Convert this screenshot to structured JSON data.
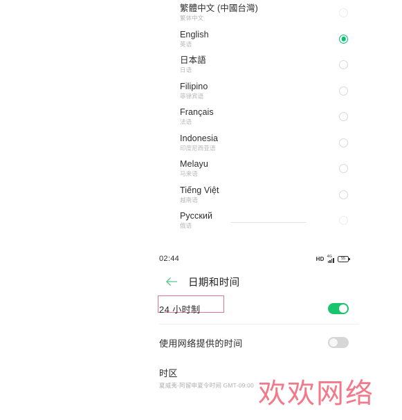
{
  "language_screen": {
    "items": [
      {
        "title": "繁體中文 (中國台灣)",
        "subtitle": "繁体中文",
        "selected": false
      },
      {
        "title": "English",
        "subtitle": "英语",
        "selected": true
      },
      {
        "title": "日本語",
        "subtitle": "日语",
        "selected": false
      },
      {
        "title": "Filipino",
        "subtitle": "菲律宾语",
        "selected": false
      },
      {
        "title": "Français",
        "subtitle": "法语",
        "selected": false
      },
      {
        "title": "Indonesia",
        "subtitle": "印度尼西亚语",
        "selected": false
      },
      {
        "title": "Melayu",
        "subtitle": "马来语",
        "selected": false
      },
      {
        "title": "Tiếng Việt",
        "subtitle": "越南语",
        "selected": false
      },
      {
        "title": "Русский",
        "subtitle": "俄语",
        "selected": false
      }
    ]
  },
  "datetime_screen": {
    "status_bar": {
      "time": "02:44",
      "hd_label": "HD",
      "network_type": "4G",
      "battery_level": "55"
    },
    "appbar": {
      "back_icon": "back-arrow-icon",
      "title": "日期和时间"
    },
    "rows": [
      {
        "label": "24 小时制",
        "subtitle": "",
        "control": "toggle",
        "state": "on"
      },
      {
        "label": "使用网络提供的时间",
        "subtitle": "",
        "control": "toggle",
        "state": "off"
      },
      {
        "label": "时区",
        "subtitle": "夏威夷-阿留申夏令时间 GMT-09:00",
        "control": "none",
        "state": ""
      }
    ]
  },
  "annotation": {
    "box_color": "#d9798a",
    "box_text": ""
  },
  "watermark": {
    "text": "欢欢网络",
    "color": "#f2798a"
  },
  "theme": {
    "accent": "#06c16f",
    "toggle_on": "#18c46c",
    "toggle_off": "#d6d6d6",
    "text_primary": "#2b2b2b",
    "text_secondary": "#b7b7b7"
  }
}
